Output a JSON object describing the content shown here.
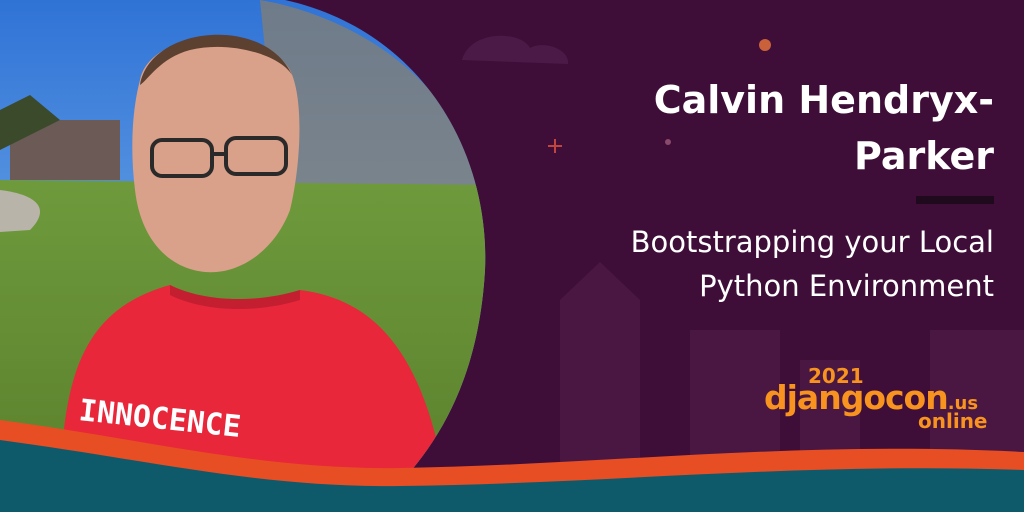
{
  "speaker": {
    "name_line1": "Calvin Hendryx-",
    "name_line2": "Parker"
  },
  "talk": {
    "title_line1": "Bootstrapping your Local",
    "title_line2": "Python Environment"
  },
  "event": {
    "year": "2021",
    "name": "djangocon",
    "tld": ".us",
    "edition": "online"
  },
  "photo": {
    "shirt_text": "INNOCENCE"
  },
  "colors": {
    "background": "#3e0e38",
    "accent_orange": "#f7931e",
    "wave_red": "#e84e24",
    "wave_teal": "#0f5a6a"
  }
}
